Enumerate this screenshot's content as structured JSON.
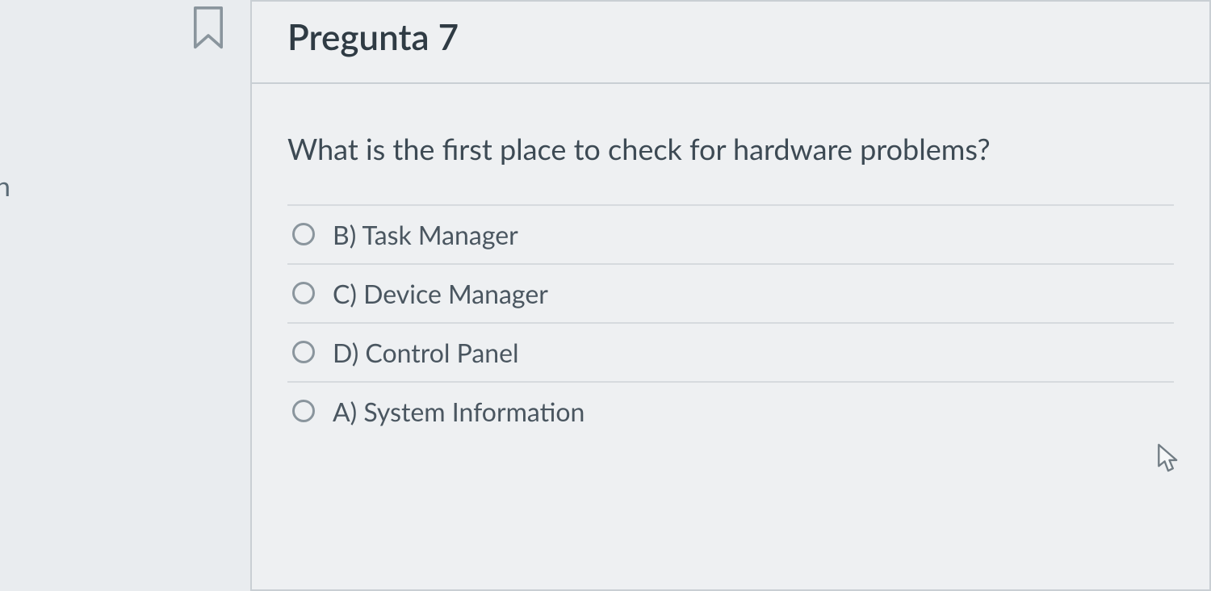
{
  "sidebar": {
    "fragment": "n"
  },
  "question": {
    "title": "Pregunta 7",
    "prompt": "What is the first place to check for hardware problems?",
    "options": [
      {
        "label": "B) Task Manager"
      },
      {
        "label": "C) Device Manager"
      },
      {
        "label": "D) Control Panel"
      },
      {
        "label": "A) System Information"
      }
    ]
  }
}
